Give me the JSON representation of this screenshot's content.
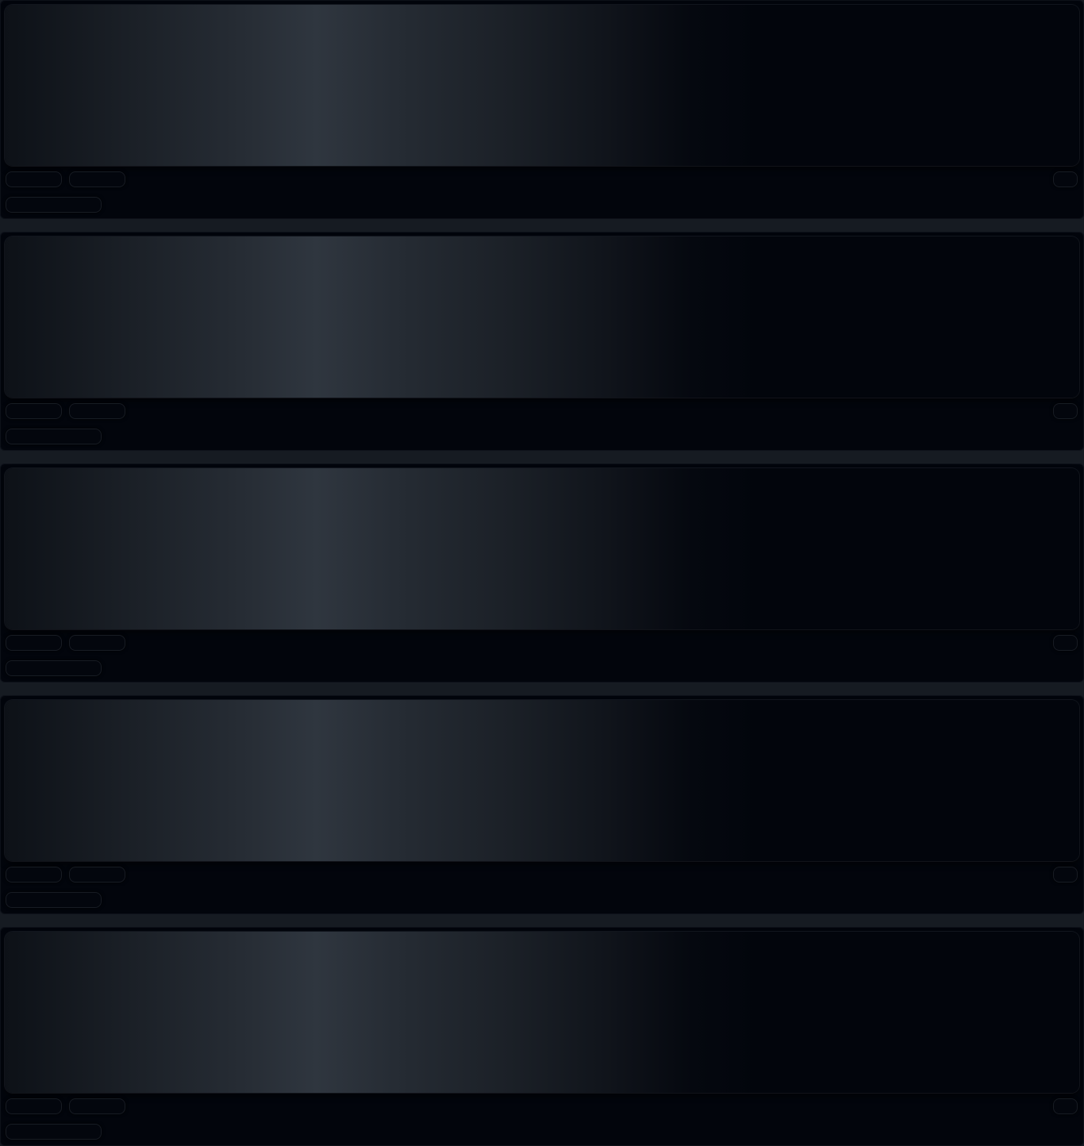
{
  "feed": {
    "cards": [
      {
        "loading": true
      },
      {
        "loading": true
      },
      {
        "loading": true
      },
      {
        "loading": true
      },
      {
        "loading": true
      }
    ]
  },
  "colors": {
    "page_background": "#161b22",
    "card_background": "#02050c",
    "shimmer_highlight": "#2f363f"
  }
}
